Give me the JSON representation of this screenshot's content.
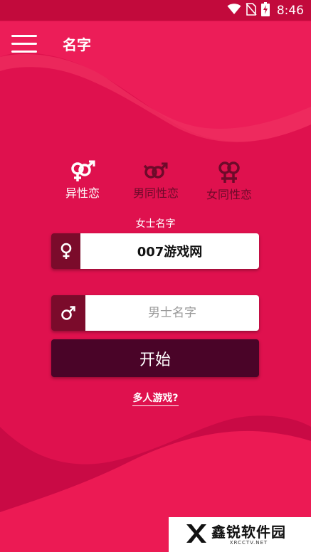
{
  "status_bar": {
    "time": "8:46",
    "icons": [
      "wifi-icon",
      "no-sim-icon",
      "battery-charging-icon"
    ]
  },
  "app_bar": {
    "title": "名字",
    "menu_icon": "hamburger-menu-icon"
  },
  "modes": [
    {
      "label": "异性恋",
      "icon": "heterosexual-icon",
      "active": true
    },
    {
      "label": "男同性恋",
      "icon": "gay-icon",
      "active": false
    },
    {
      "label": "女同性恋",
      "icon": "lesbian-icon",
      "active": false
    }
  ],
  "form": {
    "female_caption": "女士名字",
    "female_symbol": "female-icon",
    "female_value": "007游戏网",
    "male_symbol": "male-icon",
    "male_placeholder": "男士名字",
    "male_value": "",
    "start_label": "开始",
    "multiplayer_link": "多人游戏?"
  },
  "watermark": {
    "title": "鑫锐软件园",
    "subtitle": "XRCCTV.NET"
  },
  "colors": {
    "background": "#e0114f",
    "status_bar": "#c20a3c",
    "symbol_box": "#7b0b2b",
    "start_button": "#4a0428",
    "inactive_label": "#6e0a2a"
  }
}
